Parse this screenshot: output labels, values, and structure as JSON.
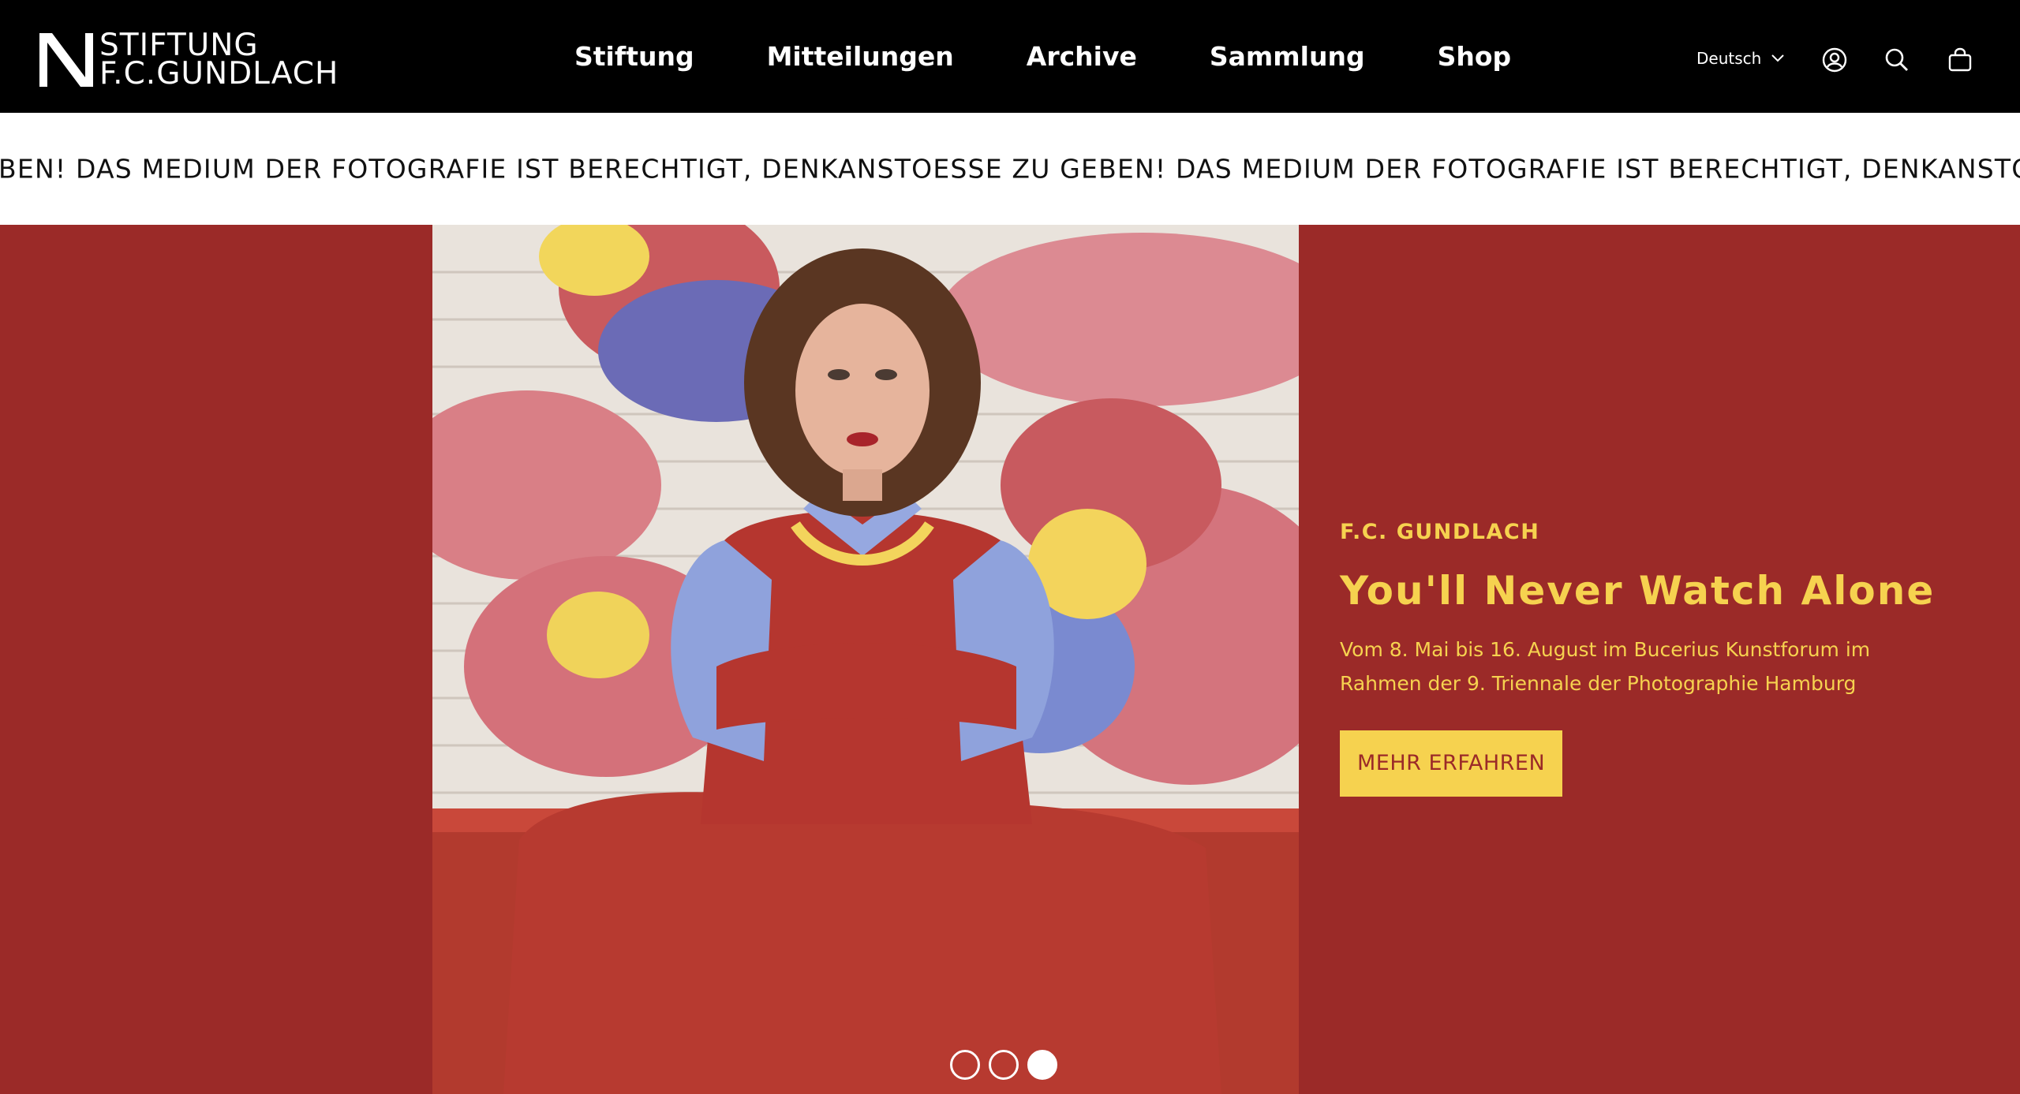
{
  "header": {
    "logo_line1": "STIFTUNG",
    "logo_line2": "F.C.GUNDLACH",
    "nav": [
      "Stiftung",
      "Mitteilungen",
      "Archive",
      "Sammlung",
      "Shop"
    ],
    "language": "Deutsch",
    "icons": [
      "account-icon",
      "search-icon",
      "cart-icon"
    ]
  },
  "ticker": {
    "text": "EBEN! DAS MEDIUM DER FOTOGRAFIE IST BERECHTIGT, DENKANSTOESSE ZU GEBEN! DAS MEDIUM DER FOTOGRAFIE IST BERECHTIGT, DENKANSTOESSE ZU"
  },
  "hero": {
    "eyebrow": "F.C. GUNDLACH",
    "title": "You'll Never Watch Alone",
    "subtitle": "Vom 8. Mai bis 16. August im Bucerius Kunstforum im Rahmen der 9. Triennale der Photographie Hamburg",
    "cta": "MEHR ERFAHREN",
    "slides_total": 3,
    "slide_active": 3
  },
  "colors": {
    "header_bg": "#000000",
    "hero_bg": "#9b2a28",
    "accent_yellow": "#f6d24f",
    "ticker_bg": "#ffffff"
  }
}
